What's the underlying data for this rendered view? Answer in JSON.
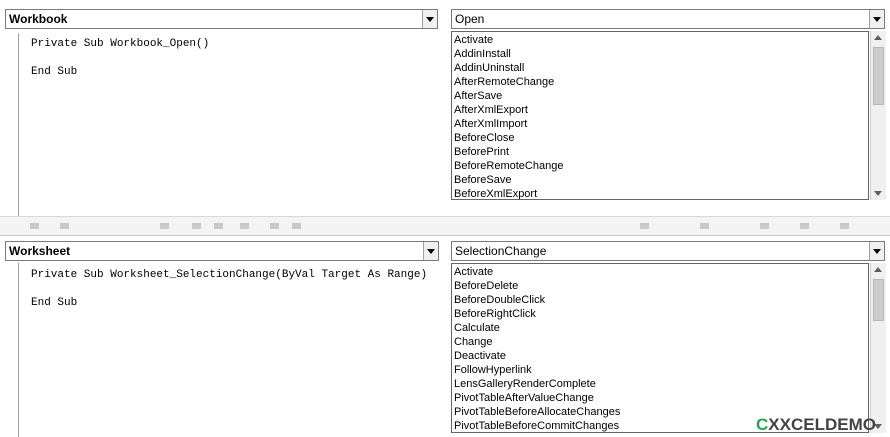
{
  "workbook_module": {
    "object_combo": "Workbook",
    "procedure_combo": "Open",
    "code_lines": [
      "Private Sub Workbook_Open()",
      "",
      "End Sub"
    ],
    "dropdown_items": [
      "Activate",
      "AddinInstall",
      "AddinUninstall",
      "AfterRemoteChange",
      "AfterSave",
      "AfterXmlExport",
      "AfterXmlImport",
      "BeforeClose",
      "BeforePrint",
      "BeforeRemoteChange",
      "BeforeSave",
      "BeforeXmlExport"
    ]
  },
  "worksheet_module": {
    "object_combo": "Worksheet",
    "procedure_combo": "SelectionChange",
    "code_lines": [
      "Private Sub Worksheet_SelectionChange(ByVal Target As Range)",
      "",
      "End Sub"
    ],
    "dropdown_items": [
      "Activate",
      "BeforeDelete",
      "BeforeDoubleClick",
      "BeforeRightClick",
      "Calculate",
      "Change",
      "Deactivate",
      "FollowHyperlink",
      "LensGalleryRenderComplete",
      "PivotTableAfterValueChange",
      "PivotTableBeforeAllocateChanges",
      "PivotTableBeforeCommitChanges"
    ]
  },
  "watermark": {
    "c": "C",
    "x": "XXCELDEMO",
    "brand": "DEMO"
  },
  "icons": {
    "combo_arrow": "chevron-down-icon",
    "scroll_up": "arrow-up-icon",
    "scroll_down": "arrow-down-icon"
  }
}
